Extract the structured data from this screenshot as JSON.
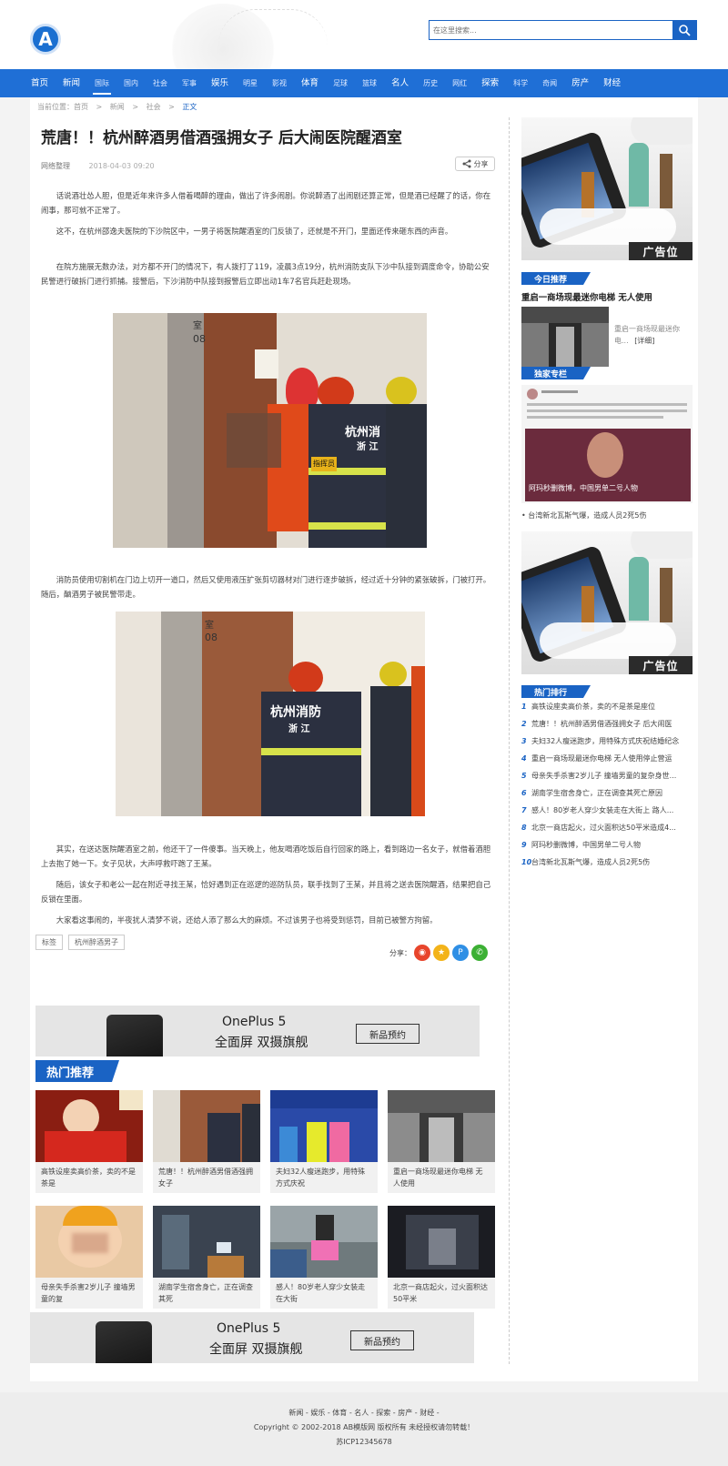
{
  "header": {
    "logo_text": "A",
    "search_placeholder": "在这里搜索..."
  },
  "nav": [
    {
      "label": "首页",
      "style": "big"
    },
    {
      "label": "新闻",
      "style": "big"
    },
    {
      "label": "国际",
      "style": "small",
      "active": true
    },
    {
      "label": "国内",
      "style": "small"
    },
    {
      "label": "社会",
      "style": "small"
    },
    {
      "label": "军事",
      "style": "small"
    },
    {
      "label": "娱乐",
      "style": "big"
    },
    {
      "label": "明星",
      "style": "small"
    },
    {
      "label": "影视",
      "style": "small"
    },
    {
      "label": "体育",
      "style": "big"
    },
    {
      "label": "足球",
      "style": "small"
    },
    {
      "label": "篮球",
      "style": "small"
    },
    {
      "label": "名人",
      "style": "big"
    },
    {
      "label": "历史",
      "style": "small"
    },
    {
      "label": "网红",
      "style": "small"
    },
    {
      "label": "探索",
      "style": "big"
    },
    {
      "label": "科学",
      "style": "small"
    },
    {
      "label": "奇闻",
      "style": "small"
    },
    {
      "label": "房产",
      "style": "big"
    },
    {
      "label": "财经",
      "style": "big"
    }
  ],
  "breadcrumb": {
    "prefix": "当前位置：首页",
    "sep": ">",
    "items": [
      "新闻",
      "社会"
    ],
    "current": "正文"
  },
  "article": {
    "title": "荒唐！！杭州醉酒男借酒强拥女子 后大闹医院醒酒室",
    "source": "网络整理",
    "date": "2018-04-03 09:20",
    "share_label": "分享",
    "paragraphs": [
      "话说酒壮怂人胆，但是近年来许多人借着喝醉的理由，做出了许多闹剧。你说醉酒了出闹剧还算正常，但是酒已经醒了的话，你在闹事，那可就不正常了。",
      "这不，在杭州邵逸夫医院的下沙院区中，一男子将医院醒酒室的门反锁了，还就是不开门，里面还传来砸东西的声音。",
      "在院方施展无数办法，对方都不开门的情况下，有人拨打了119，凌晨3点19分，杭州消防支队下沙中队接到调度命令，协助公安民警进行破拆门进行抓捕。接警后，下沙消防中队接到报警后立即出动1车7名官兵赶赴现场。",
      "消防员使用切割机在门边上切开一道口，然后又使用液压扩张剪切器材对门进行逐步破拆，经过近十分钟的紧张破拆，门被打开。随后，酗酒男子被民警带走。",
      "其实，在送达医院醒酒室之前，他还干了一件傻事。当天晚上，他友喝酒吃饭后自行回家的路上，看到路边一名女子，就借着酒胆上去抱了她一下。女子见状，大声呼救吓跑了王某。",
      "随后，该女子和老公一起在附近寻找王某，恰好遇到正在巡逻的巡防队员，联手找到了王某，并且将之送去医院醒酒，结果把自己反锁在里面。",
      "大家看这事闹的，半夜扰人清梦不说，还给人添了那么大的麻烦。不过该男子也将受到惩罚，目前已被警方拘留。"
    ],
    "photo1": {
      "room": "室",
      "number": "08",
      "jacket": "杭州消",
      "province": "浙 江",
      "badge": "指挥员"
    },
    "photo2": {
      "room": "室",
      "number": "08",
      "jacket": "杭州消防",
      "province": "浙 江"
    },
    "tags_label": "标签",
    "tags": [
      "杭州醉酒男子"
    ],
    "share_row_label": "分享："
  },
  "ad_oneplus": {
    "title": "OnePlus 5",
    "sub": "全面屏 双摄旗舰",
    "button": "新品预约"
  },
  "hot_recommend": {
    "title": "热门推荐",
    "cards": [
      {
        "caption": "高铁设座卖高价茶，卖的不是茶是"
      },
      {
        "caption": "荒唐！！杭州醉酒男借酒强拥女子"
      },
      {
        "caption": "夫妇32人瘦迷跑步，用特殊方式庆祝"
      },
      {
        "caption": "重启一商场现最迷你电梯 无人使用"
      },
      {
        "caption": "母亲失手杀害2岁儿子 撞墙男童的复"
      },
      {
        "caption": "湖南学生宿舍身亡，正在调查其死"
      },
      {
        "caption": "感人！80岁老人穿少女装走在大街"
      },
      {
        "caption": "北京一商店起火，过火面积达50平米"
      }
    ]
  },
  "sidebar": {
    "ad_label": "广告位",
    "today_title": "今日推荐",
    "today_headline": "重启一商场现最迷你电梯 无人使用",
    "today_excerpt": "重启一商场现最迷你电...",
    "today_more": "[详细]",
    "exclusive_title": "独家专栏",
    "exclusive_caption": "阿玛秒删微博，中国男单二号人物",
    "exclusive_link": "台湾新北瓦斯气爆，造成人员2死5伤",
    "hot_rank_title": "热门排行",
    "hot_rank": [
      "高铁设座卖高价茶，卖的不是茶是座位",
      "荒唐！！杭州醉酒男借酒强拥女子 后大闹医",
      "夫妇32人瘦迷跑步，用特殊方式庆祝结婚纪念",
      "重启一商场现最迷你电梯 无人使用停止营运",
      "母亲失手杀害2岁儿子 撞墙男童的复杂身世...",
      "湖南学生宿舍身亡，正在调查其死亡原因",
      "感人！80岁老人穿少女装走在大街上 路人...",
      "北京一商店起火，过火面积达50平米造成4...",
      "阿玛秒删微博，中国男单二号人物",
      "台湾新北瓦斯气爆，造成人员2死5伤"
    ]
  },
  "footer": {
    "links": "新闻 - 娱乐 - 体育 - 名人 - 探索 - 房产 - 财经 -",
    "copyright": "Copyright © 2002-2018 AB模版网 版权所有 未经授权请勿转载！",
    "icp": "苏ICP12345678"
  },
  "colors": {
    "brand_blue": "#1f6fd6",
    "ribbon_blue": "#1a63c4"
  }
}
